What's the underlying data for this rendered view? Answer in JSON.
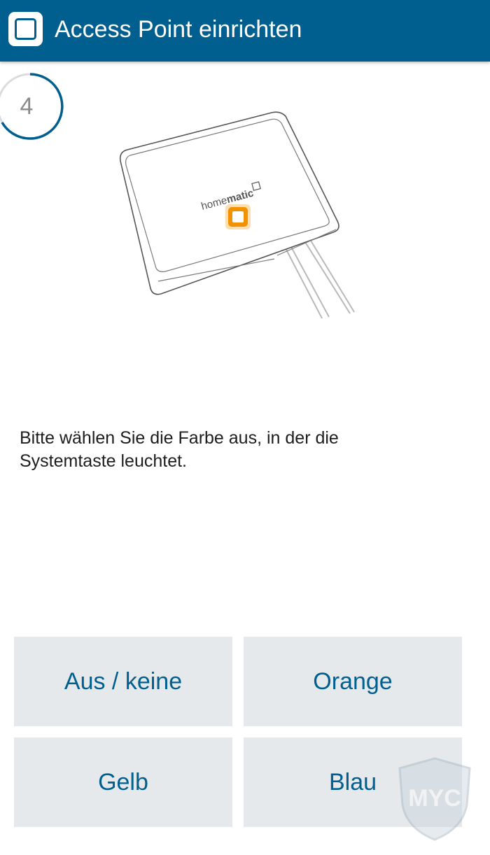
{
  "app_bar": {
    "title": "Access Point einrichten",
    "icon": "homematic-app-icon",
    "background_color": "#005f8f"
  },
  "step": {
    "number": "4",
    "progress_color": "#005f8f"
  },
  "illustration": {
    "brand_label": "home",
    "brand_label_bold": "matic",
    "system_button_color": "#f39200"
  },
  "instruction": "Bitte wählen Sie die Farbe aus, in der die Systemtaste leuchtet.",
  "choices": [
    {
      "label": "Aus / keine"
    },
    {
      "label": "Orange"
    },
    {
      "label": "Gelb"
    },
    {
      "label": "Blau"
    }
  ],
  "watermark": {
    "letters": "MYC"
  }
}
